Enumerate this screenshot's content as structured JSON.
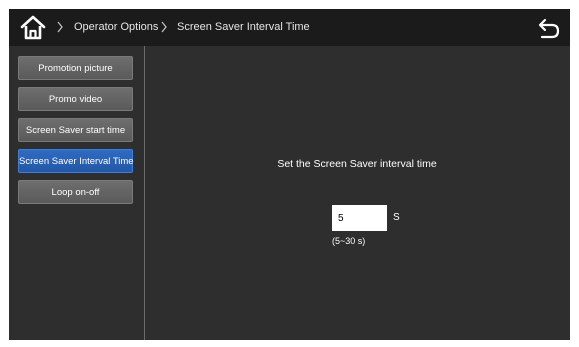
{
  "header": {
    "home_icon": "home-icon",
    "back_icon": "return-arrow-icon",
    "breadcrumb": [
      "Operator Options",
      "Screen Saver Interval Time"
    ]
  },
  "sidebar": {
    "items": [
      {
        "label": "Promotion picture",
        "active": false
      },
      {
        "label": "Promo video",
        "active": false
      },
      {
        "label": "Screen Saver start time",
        "active": false
      },
      {
        "label": "Screen Saver Interval Time",
        "active": true
      },
      {
        "label": "Loop on-off",
        "active": false
      }
    ]
  },
  "main": {
    "title": "Set the Screen Saver interval time",
    "interval_value": "5",
    "unit": "S",
    "range_hint": "(5~30 s)"
  },
  "colors": {
    "topbar": "#1b1b1b",
    "background": "#2e2e2e",
    "button": "#626262",
    "active_button": "#2a60b4"
  }
}
